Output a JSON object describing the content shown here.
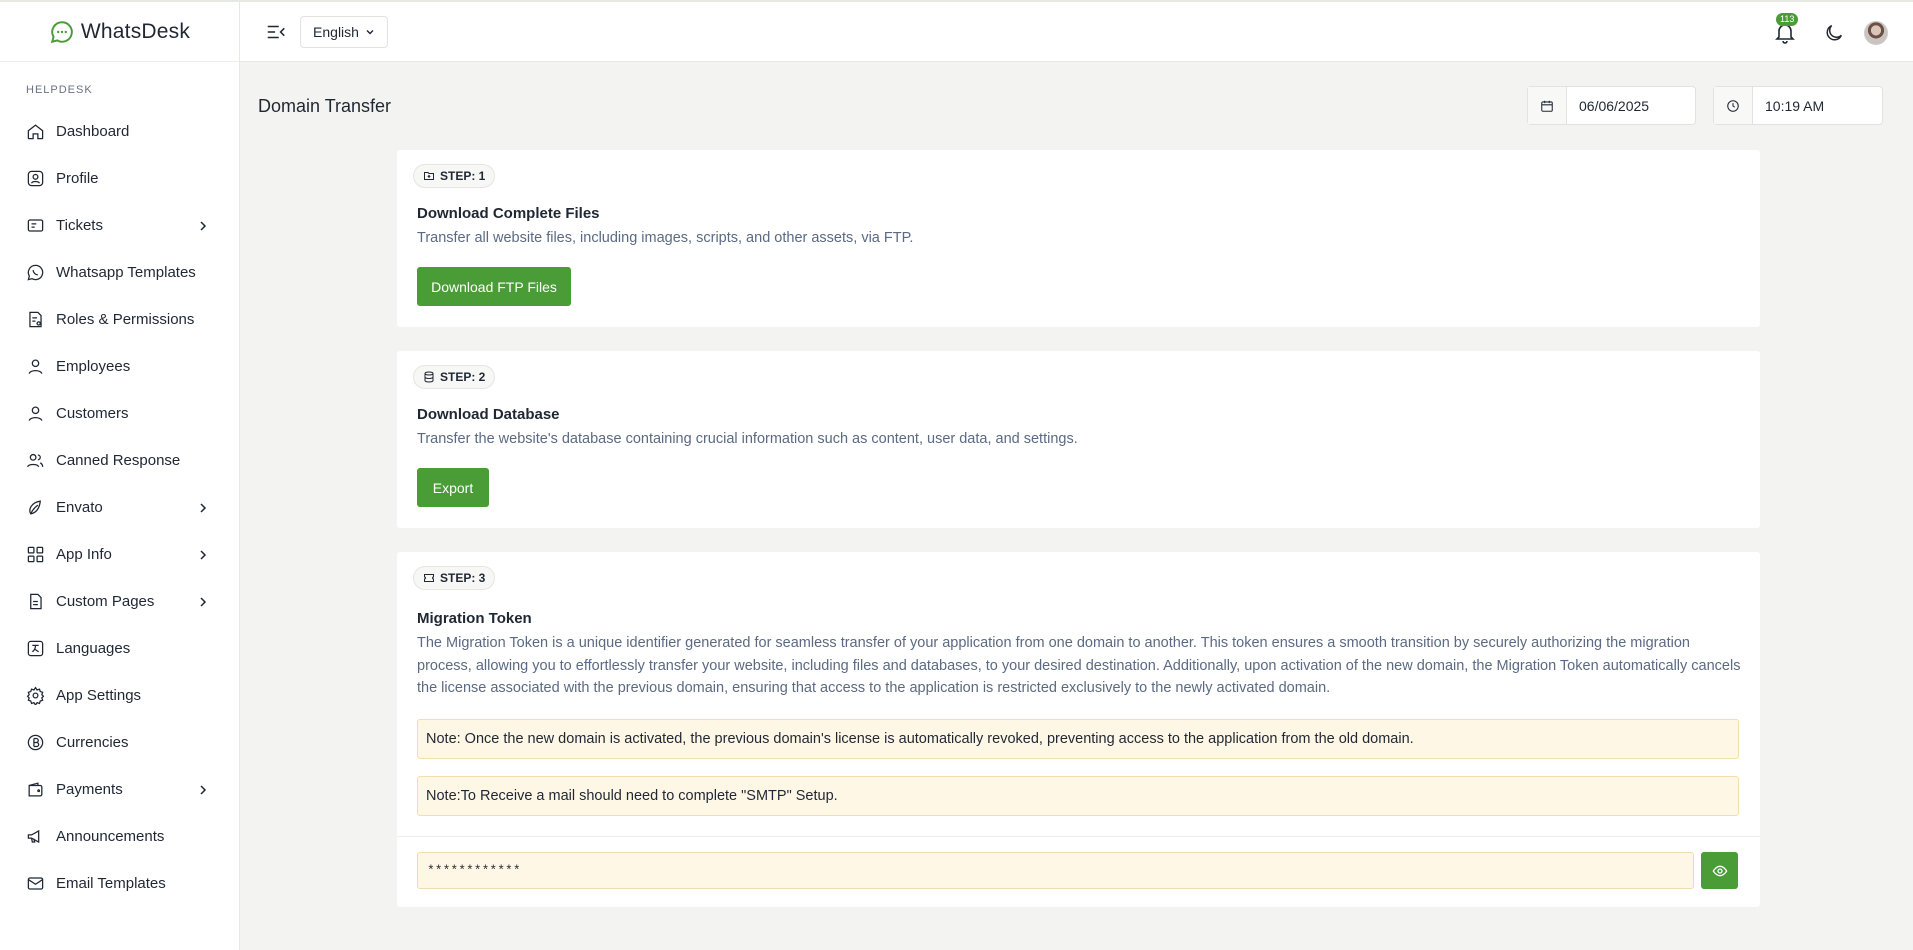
{
  "brand": {
    "name": "WhatsDesk"
  },
  "sidebar": {
    "section_label": "HELPDESK",
    "items": [
      {
        "label": "Dashboard",
        "icon": "home-icon",
        "has_submenu": false
      },
      {
        "label": "Profile",
        "icon": "profile-icon",
        "has_submenu": false
      },
      {
        "label": "Tickets",
        "icon": "ticket-icon",
        "has_submenu": true
      },
      {
        "label": "Whatsapp Templates",
        "icon": "whatsapp-icon",
        "has_submenu": false
      },
      {
        "label": "Roles & Permissions",
        "icon": "permissions-icon",
        "has_submenu": false
      },
      {
        "label": "Employees",
        "icon": "user-icon",
        "has_submenu": false
      },
      {
        "label": "Customers",
        "icon": "user-icon",
        "has_submenu": false
      },
      {
        "label": "Canned Response",
        "icon": "users-icon",
        "has_submenu": false
      },
      {
        "label": "Envato",
        "icon": "leaf-icon",
        "has_submenu": true
      },
      {
        "label": "App Info",
        "icon": "grid-icon",
        "has_submenu": true
      },
      {
        "label": "Custom Pages",
        "icon": "page-icon",
        "has_submenu": true
      },
      {
        "label": "Languages",
        "icon": "language-icon",
        "has_submenu": false
      },
      {
        "label": "App Settings",
        "icon": "gear-icon",
        "has_submenu": false
      },
      {
        "label": "Currencies",
        "icon": "currency-icon",
        "has_submenu": false
      },
      {
        "label": "Payments",
        "icon": "wallet-icon",
        "has_submenu": true
      },
      {
        "label": "Announcements",
        "icon": "megaphone-icon",
        "has_submenu": false
      },
      {
        "label": "Email Templates",
        "icon": "mail-icon",
        "has_submenu": false
      }
    ]
  },
  "header": {
    "language": "English",
    "notification_count": "113"
  },
  "page": {
    "title": "Domain Transfer",
    "date": "06/06/2025",
    "time": "10:19 AM"
  },
  "steps": [
    {
      "badge": "STEP: 1",
      "title": "Download Complete Files",
      "description": "Transfer all website files, including images, scripts, and other assets, via FTP.",
      "button": "Download FTP Files"
    },
    {
      "badge": "STEP: 2",
      "title": "Download Database",
      "description": "Transfer the website's database containing crucial information such as content, user data, and settings.",
      "button": "Export"
    },
    {
      "badge": "STEP: 3",
      "title": "Migration Token",
      "description": "The Migration Token is a unique identifier generated for seamless transfer of your application from one domain to another. This token ensures a smooth transition by securely authorizing the migration process, allowing you to effortlessly transfer your website, including files and databases, to your desired destination. Additionally, upon activation of the new domain, the Migration Token automatically cancels the license associated with the previous domain, ensuring that access to the application is restricted exclusively to the newly activated domain.",
      "notes": [
        "Note: Once the new domain is activated, the previous domain's license is automatically revoked, preventing access to the application from the old domain.",
        "Note:To Receive a mail should need to complete \"SMTP\" Setup."
      ],
      "token_value": "************"
    }
  ],
  "colors": {
    "accent": "#4a9c37",
    "note_bg": "#fff7e6",
    "desc_text": "#5b6a82"
  }
}
